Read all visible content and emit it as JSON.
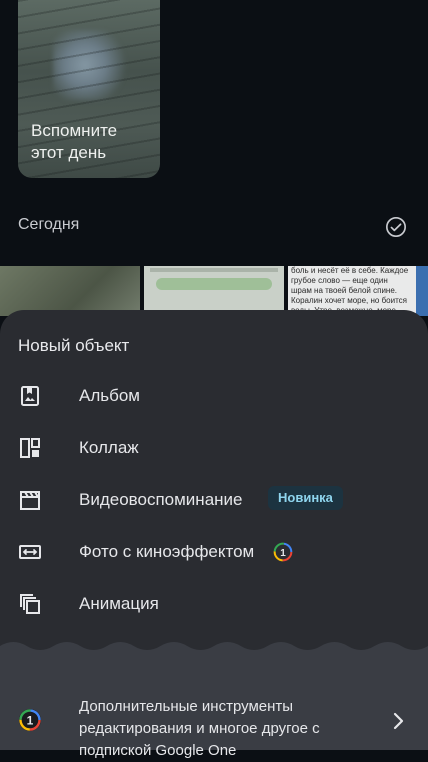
{
  "memory_card": {
    "label": "Вспомните этот день"
  },
  "section": {
    "title": "Сегодня"
  },
  "thumbnails": {
    "snippet_text": "боль и несёт её в себе. Каждое грубое слово — еще один шрам на твоей белой спине. Коралин хочет море, но боится воды. Утро, возможно, море."
  },
  "sheet": {
    "title": "Новый объект",
    "items": [
      {
        "label": "Альбом",
        "icon": "album-icon"
      },
      {
        "label": "Коллаж",
        "icon": "collage-icon"
      },
      {
        "label": "Видеовоспоминание",
        "icon": "clapperboard-icon",
        "badge": "Новинка"
      },
      {
        "label": "Фото с киноэффектом",
        "icon": "cinematic-photo-icon"
      },
      {
        "label": "Анимация",
        "icon": "animation-icon"
      }
    ],
    "promo": {
      "text": "Дополнительные инструменты редактирования и многое другое с подпиской Google One",
      "icon": "google-one-icon"
    }
  },
  "colors": {
    "background": "#0b0f14",
    "sheet": "#2a2c31",
    "promo": "#3a3d44",
    "badge_bg": "#1c3340",
    "badge_text": "#8fd5ee"
  }
}
